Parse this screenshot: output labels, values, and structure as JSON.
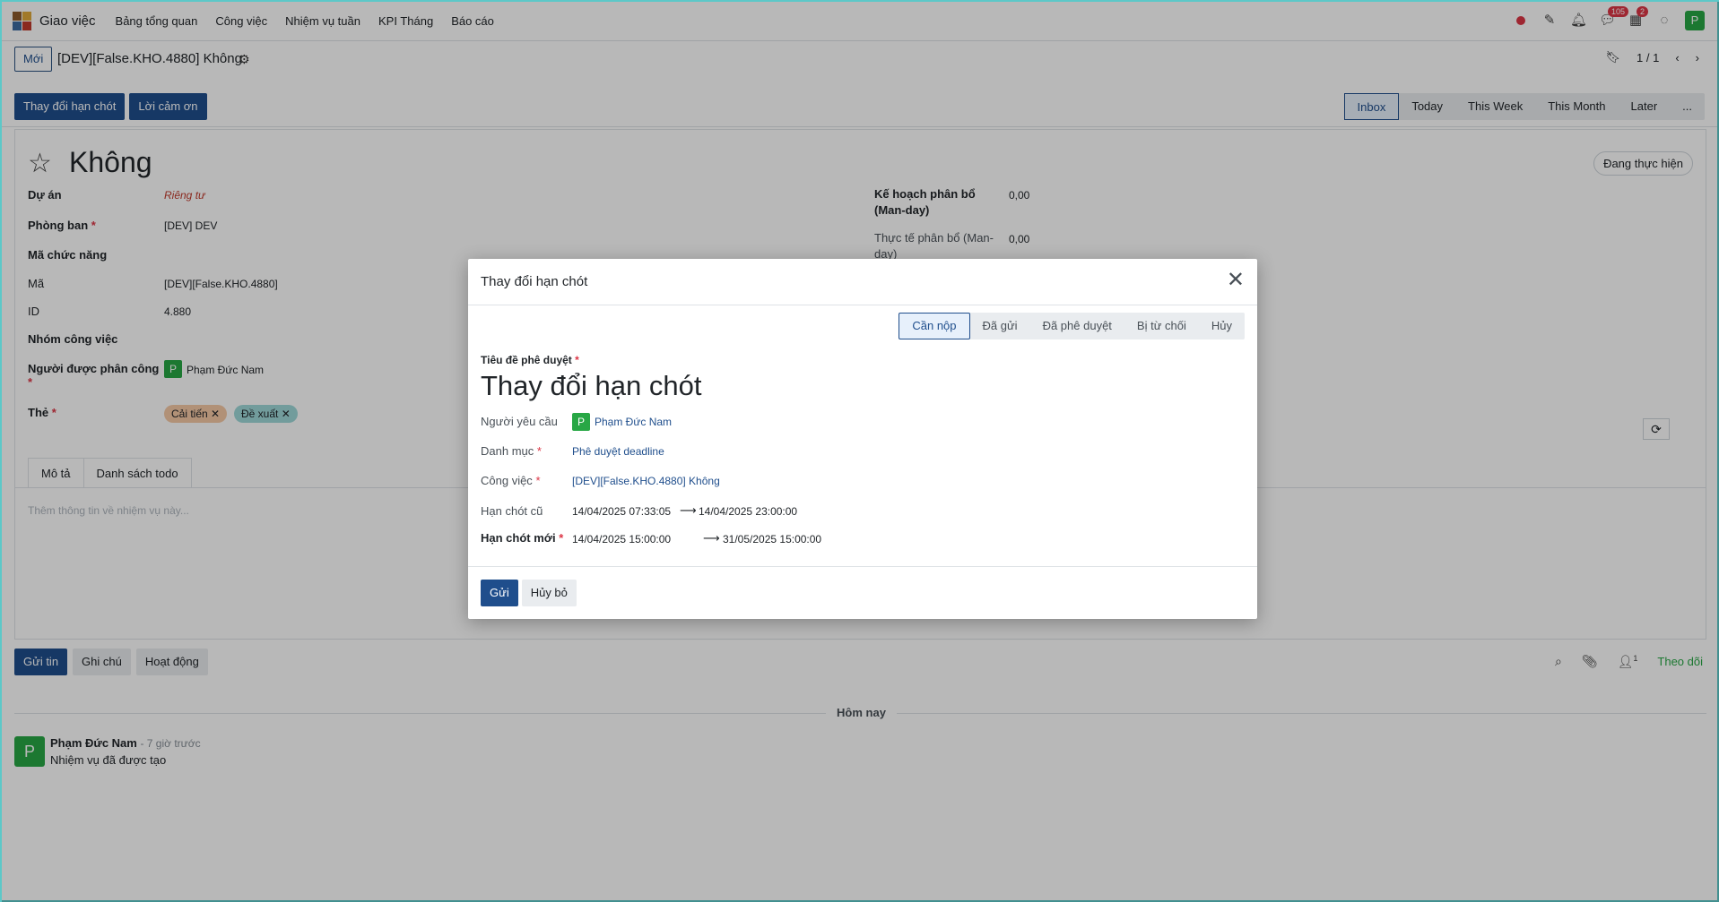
{
  "app": {
    "title": "Giao việc",
    "menu": [
      "Bảng tổng quan",
      "Công việc",
      "Nhiệm vụ tuần",
      "KPI Tháng",
      "Báo cáo"
    ],
    "messages_count": "105",
    "activity_count": "2",
    "user_initial": "P"
  },
  "control": {
    "new_label": "Mới",
    "breadcrumb": "[DEV][False.KHO.4880] Không",
    "pager": "1 / 1",
    "actions": [
      "Thay đổi hạn chót",
      "Lời cảm ơn"
    ],
    "filters": [
      "Inbox",
      "Today",
      "This Week",
      "This Month",
      "Later",
      "..."
    ]
  },
  "record": {
    "title": "Không",
    "stage": "Đang thực hiện",
    "fields": {
      "du_an_label": "Dự án",
      "du_an_value": "Riêng tư",
      "phong_ban_label": "Phòng ban",
      "phong_ban_value": "[DEV] DEV",
      "ma_chuc_nang_label": "Mã chức năng",
      "ma_label": "Mã",
      "ma_value": "[DEV][False.KHO.4880]",
      "id_label": "ID",
      "id_value": "4.880",
      "nhom_label": "Nhóm công việc",
      "nguoi_label": "Người được phân công",
      "nguoi_value": "Phạm Đức Nam",
      "the_label": "Thẻ",
      "tags": [
        "Cải tiến",
        "Đề xuất"
      ],
      "ke_hoach_label": "Kế hoạch phân bổ (Man-day)",
      "ke_hoach_value": "0,00",
      "thuc_te_label": "Thực tế phân bổ (Man-day)",
      "thuc_te_value": "0,00"
    },
    "tabs": [
      "Mô tả",
      "Danh sách todo"
    ],
    "description_placeholder": "Thêm thông tin về nhiệm vụ này..."
  },
  "chatter": {
    "buttons": [
      "Gửi tin",
      "Ghi chú",
      "Hoạt động"
    ],
    "follower_count": "1",
    "follow_label": "Theo dõi",
    "separator": "Hôm nay",
    "message": {
      "author": "Phạm Đức Nam",
      "time": "- 7 giờ trước",
      "body": "Nhiệm vụ đã được tạo",
      "initial": "P"
    }
  },
  "modal": {
    "title": "Thay đổi hạn chót",
    "steps": [
      "Cần nộp",
      "Đã gửi",
      "Đã phê duyệt",
      "Bị từ chối",
      "Hủy"
    ],
    "approval_title_label": "Tiêu đề phê duyệt",
    "approval_title_value": "Thay đổi hạn chót",
    "requester_label": "Người yêu cầu",
    "requester_value": "Phạm Đức Nam",
    "requester_initial": "P",
    "category_label": "Danh mục",
    "category_value": "Phê duyệt deadline",
    "task_label": "Công việc",
    "task_value": "[DEV][False.KHO.4880] Không",
    "old_deadline_label": "Hạn chót cũ",
    "old_start": "14/04/2025 07:33:05",
    "old_end": "14/04/2025 23:00:00",
    "new_deadline_label": "Hạn chót mới",
    "new_start": "14/04/2025 15:00:00",
    "new_end": "31/05/2025 15:00:00",
    "send_label": "Gửi",
    "cancel_label": "Hủy bỏ"
  },
  "colors": {
    "primary": "#1f4e8c",
    "success": "#28a745",
    "danger": "#dc3545",
    "tag_orange": "#f6c9a5",
    "tag_teal": "#9fd9d9"
  }
}
